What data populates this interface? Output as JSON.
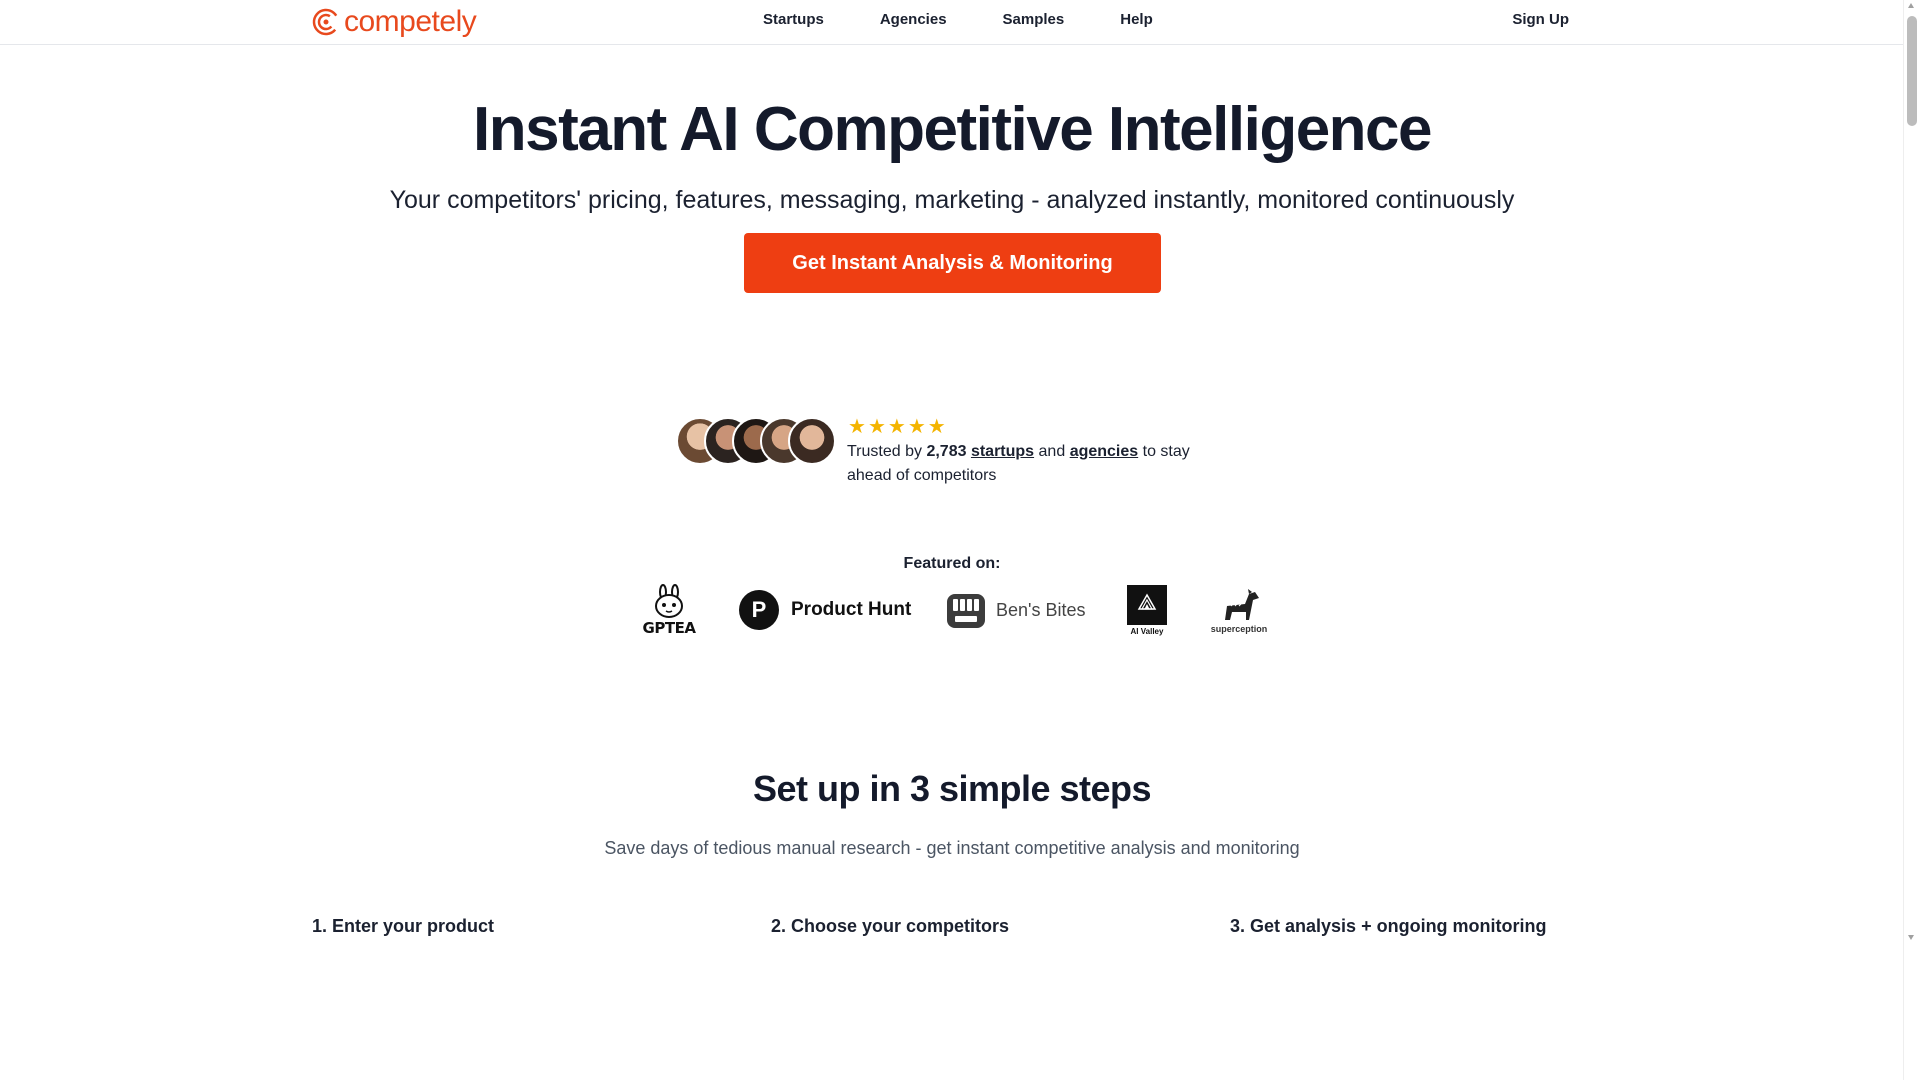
{
  "brand": {
    "name": "competely",
    "color": "#e8491d"
  },
  "nav": {
    "items": [
      {
        "label": "Startups"
      },
      {
        "label": "Agencies"
      },
      {
        "label": "Samples"
      },
      {
        "label": "Help"
      }
    ],
    "signup_label": "Sign Up"
  },
  "hero": {
    "title": "Instant AI Competitive Intelligence",
    "subtitle": "Your competitors' pricing, features, messaging, marketing - analyzed instantly, monitored continuously",
    "cta_label": "Get Instant Analysis & Monitoring",
    "cta_color": "#ee3e12"
  },
  "social_proof": {
    "rating_stars": 5,
    "star_glyph": "★",
    "trusted_prefix": "Trusted by",
    "count": "2,783",
    "startups_link": "startups",
    "and_text": "and",
    "agencies_link": "agencies",
    "suffix": "to stay ahead of competitors",
    "avatars": [
      "avatar-1",
      "avatar-2",
      "avatar-3",
      "avatar-4",
      "avatar-5"
    ]
  },
  "featured": {
    "label": "Featured on:",
    "logos": [
      {
        "name": "GPTEA",
        "text": "GPTEA"
      },
      {
        "name": "Product Hunt",
        "text": "Product Hunt",
        "mark": "P"
      },
      {
        "name": "Ben's Bites",
        "text": "Ben's Bites"
      },
      {
        "name": "AI Valley",
        "text": "AI Valley"
      },
      {
        "name": "superception",
        "text": "superception"
      }
    ]
  },
  "steps": {
    "title": "Set up in 3 simple steps",
    "subtitle": "Save days of tedious manual research - get instant competitive analysis and monitoring",
    "items": [
      {
        "label": "1. Enter your product"
      },
      {
        "label": "2. Choose your competitors"
      },
      {
        "label": "3. Get analysis + ongoing monitoring"
      }
    ]
  }
}
